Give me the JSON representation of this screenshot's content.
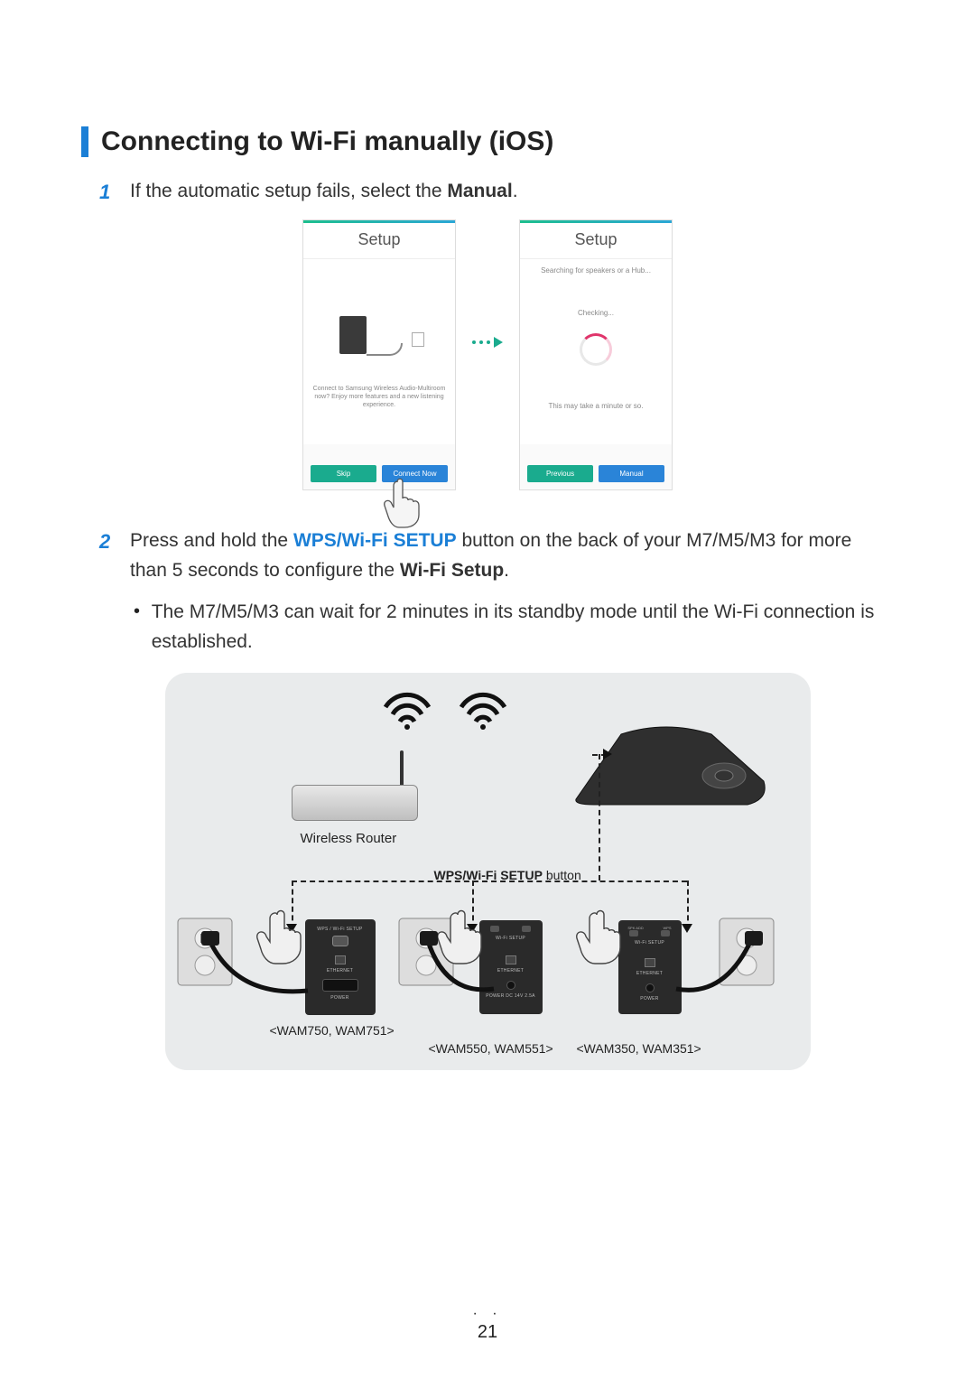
{
  "title": "Connecting to Wi-Fi manually (iOS)",
  "step1": {
    "num": "1",
    "pre": "If the automatic setup fails, select the ",
    "bold": "Manual",
    "post": "."
  },
  "step2": {
    "num": "2",
    "t1": "Press and hold the ",
    "wps": "WPS/Wi-Fi SETUP",
    "t2": " button on the back of your M7/M5/M3 for more than 5 seconds to configure the ",
    "wfs": "Wi-Fi Setup",
    "t3": "."
  },
  "bullet": {
    "text": "The M7/M5/M3 can wait for 2 minutes in its standby mode until the Wi-Fi connection is established."
  },
  "phone1": {
    "title": "Setup",
    "caption": "Connect to Samsung Wireless Audio-Multiroom now? Enjoy more features and a new listening experience.",
    "skip": "Skip",
    "connect": "Connect Now"
  },
  "phone2": {
    "title": "Setup",
    "searching": "Searching for speakers or a Hub...",
    "checking": "Checking...",
    "minute": "This may take a minute or so.",
    "previous": "Previous",
    "manual": "Manual"
  },
  "diagram": {
    "router_label": "Wireless Router",
    "wps_button_bold": "WPS/Wi-Fi SETUP",
    "wps_button_rest": " button",
    "model_750": "<WAM750, WAM751>",
    "model_550": "<WAM550, WAM551>",
    "model_350": "<WAM350, WAM351>",
    "panel_wps": "WPS /\nWi-Fi SETUP",
    "panel_wifi": "Wi-Fi SETUP",
    "panel_eth": "ETHERNET",
    "panel_power": "POWER",
    "panel_power2": "POWER\nDC 14V 2.5A",
    "panel_spk": "SPK ADD",
    "panel_wps2": "WPS",
    "panel_wifisetup": "Wi-Fi SETUP"
  },
  "page": {
    "dots": "· ·",
    "number": "21"
  }
}
